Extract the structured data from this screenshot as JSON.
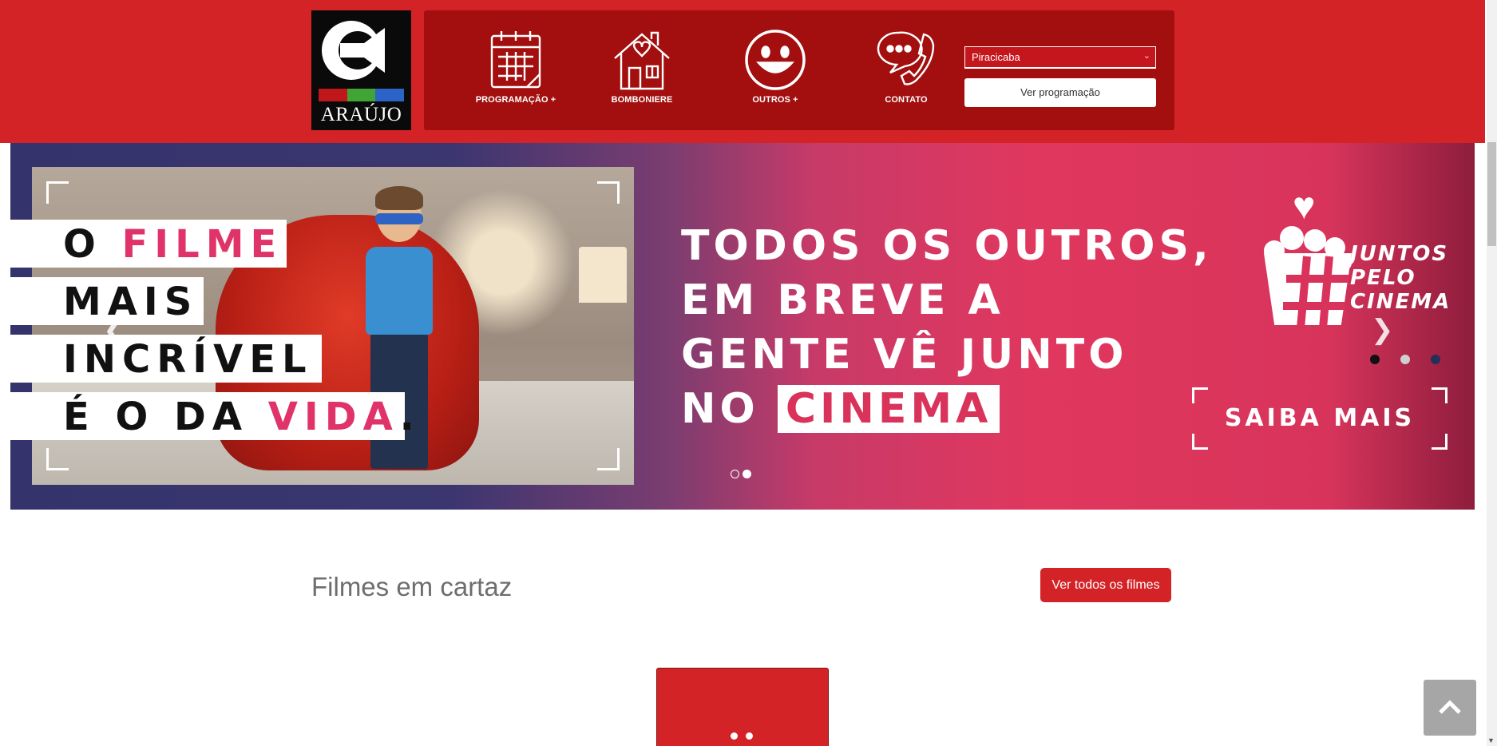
{
  "brand": {
    "name": "ARAÚJO",
    "colors": {
      "primary_red": "#d42327",
      "nav_dark_red": "#a30f0f",
      "banner_pink": "#e0375e",
      "banner_blue": "#34336c"
    },
    "logo_bar_colors": [
      "#c0171a",
      "#41a535",
      "#2c63c6"
    ]
  },
  "nav": {
    "items": [
      {
        "label": "PROGRAMAÇÃO +",
        "icon": "calendar-icon"
      },
      {
        "label": "BOMBONIERE",
        "icon": "house-icon"
      },
      {
        "label": "OUTROS +",
        "icon": "smiley-icon"
      },
      {
        "label": "CONTATO",
        "icon": "phone-chat-icon"
      }
    ],
    "city_select": {
      "value": "Piracicaba"
    },
    "ver_programacao": "Ver programação"
  },
  "banner": {
    "left_lines": [
      {
        "pre": "O ",
        "highlight": "FILME",
        "post": ""
      },
      {
        "pre": "MAIS",
        "highlight": "",
        "post": ""
      },
      {
        "pre": "INCRÍVEL",
        "highlight": "",
        "post": ""
      },
      {
        "pre": "É O DA ",
        "highlight": "VIDA",
        "post": "."
      }
    ],
    "headline": [
      "TODOS OS OUTROS,",
      "EM BREVE A",
      "GENTE VÊ JUNTO"
    ],
    "headline_last_pre": "NO ",
    "headline_last_boxed": "CINEMA",
    "campaign": [
      "JUNTOS",
      "PELO",
      "CINEMA"
    ],
    "campaign_hash": "#",
    "cta": "SAIBA MAIS",
    "prev_icon": "chevron-left-icon",
    "next_icon": "chevron-right-icon",
    "inner_dots": [
      "#111111",
      "#cfcfcf",
      "#23305a"
    ],
    "outer_dots": {
      "count": 2,
      "active_index": 1
    }
  },
  "section": {
    "title": "Filmes em cartaz",
    "button": "Ver todos os filmes"
  },
  "back_to_top_icon": "chevron-up-icon"
}
